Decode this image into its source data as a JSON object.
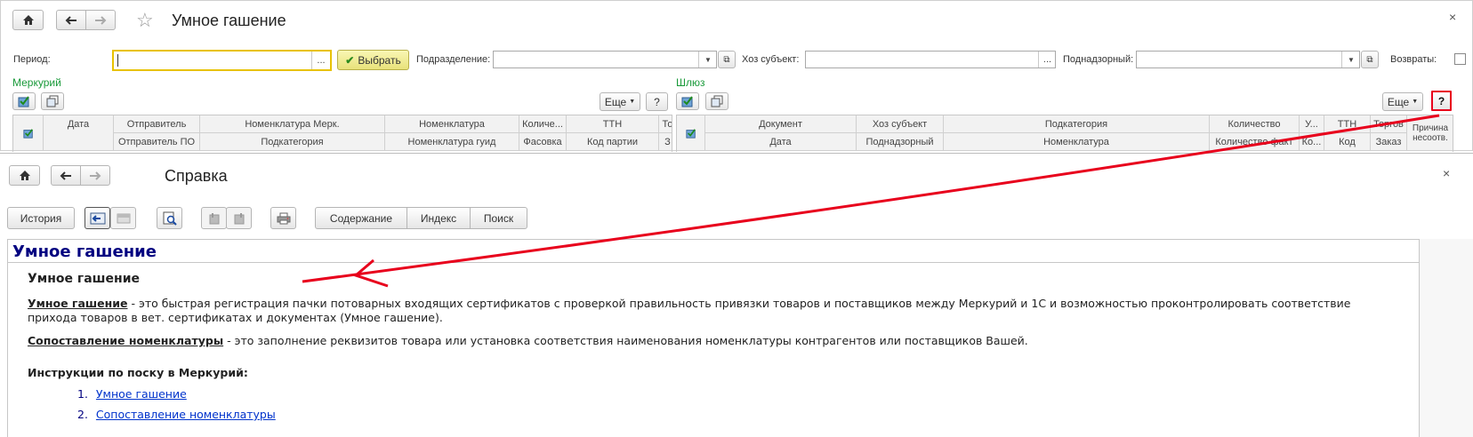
{
  "top_window": {
    "title": "Умное гашение",
    "close": "×",
    "filters": {
      "period_label": "Период:",
      "period_value": "",
      "period_btn": "...",
      "select_btn": "Выбрать",
      "division_label": "Подразделение:",
      "division_value": "",
      "counterparty_label": "Хоз субъект:",
      "counterparty_value": "",
      "counterparty_btn": "...",
      "supervised_label": "Поднадзорный:",
      "supervised_value": "",
      "returns_label": "Возвраты:"
    },
    "mercury": {
      "title": "Меркурий",
      "more_btn": "Еще",
      "help_btn": "?",
      "header_row1": [
        "Дата",
        "Отправитель",
        "Номенклатура Мерк.",
        "Номенклатура",
        "Количе...",
        "ТТН",
        "То"
      ],
      "header_row2": [
        "Отправитель ПО",
        "Подкатегория",
        "Номенклатура гуид",
        "Фасовка",
        "Код партии",
        "З"
      ]
    },
    "gateway": {
      "title": "Шлюз",
      "more_btn": "Еще",
      "help_btn": "?",
      "header_row1": [
        "Документ",
        "Хоз субъект",
        "Подкатегория",
        "Количество",
        "У...",
        "ТТН",
        "Торгов",
        "Причина несоотв."
      ],
      "header_row2": [
        "Дата",
        "Поднадзорный",
        "Номенклатура",
        "Количество факт",
        "Ко...",
        "Код",
        "Заказ"
      ]
    }
  },
  "help_window": {
    "title": "Справка",
    "close": "×",
    "toolbar": {
      "history": "История",
      "contents": "Содержание",
      "index": "Индекс",
      "search": "Поиск"
    },
    "page_title": "Умное гашение",
    "section_title": "Умное гашение",
    "para1_term": "Умное гашение",
    "para1_text": " - это быстрая регистрация пачки потоварных входящих сертификатов с проверкой правильность привязки товаров и поставщиков между Меркурий и 1С и возможностью проконтролировать соответствие прихода товаров в вет. сертификатах и документах (Умное гашение).",
    "para2_term": "Сопоставление номенклатуры",
    "para2_text": " - это заполнение реквизитов товара или установка соответствия наименования номенклатуры контрагентов или поставщиков Вашей.",
    "instructions_title": "Инструкции по поску в Меркурий:",
    "links": [
      "Умное гашение",
      "Сопоставление номенклатуры"
    ],
    "numbers": [
      "1.",
      "2."
    ]
  },
  "colors": {
    "accent_green": "#1a9a3a",
    "highlight_red": "#e8001c",
    "link_blue": "#0033cc",
    "title_navy": "#000080",
    "period_border": "#e8c200"
  }
}
